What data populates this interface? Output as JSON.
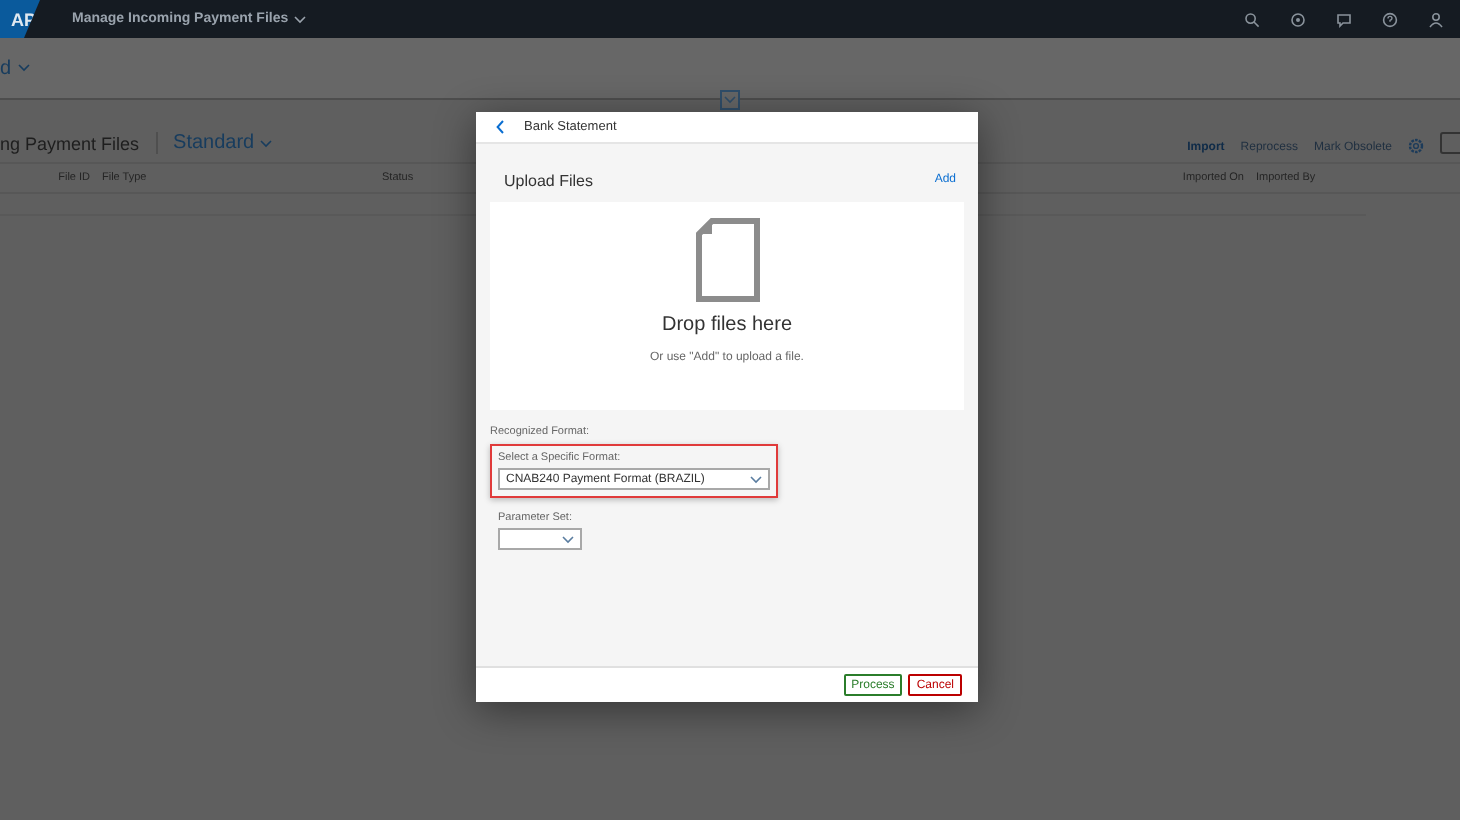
{
  "shell": {
    "logo": "AP",
    "title": "Manage Incoming Payment Files"
  },
  "header": {
    "variant": "d"
  },
  "table": {
    "title": "ng Payment Files",
    "variant": "Standard",
    "actions": [
      {
        "label": "Import",
        "disabled": false
      },
      {
        "label": "Reprocess",
        "disabled": true
      },
      {
        "label": "Mark Obsolete",
        "disabled": true
      }
    ],
    "columns": [
      "File ID",
      "File Type",
      "Status",
      "Imported On",
      "Imported By"
    ]
  },
  "dialog": {
    "title": "Bank Statement",
    "section": "Upload Files",
    "add": "Add",
    "drop_title": "Drop files here",
    "drop_hint": "Or use \"Add\" to upload a file.",
    "recognized_label": "Recognized Format:",
    "fields": [
      {
        "label": "Select a Specific Format:",
        "value": "CNAB240 Payment Format (BRAZIL)",
        "highlighted": true
      },
      {
        "label": "Parameter Set:",
        "highlighted": false
      }
    ],
    "buttons": [
      {
        "label": "Process",
        "kind": "accept"
      },
      {
        "label": "Cancel",
        "kind": "reject"
      }
    ]
  }
}
